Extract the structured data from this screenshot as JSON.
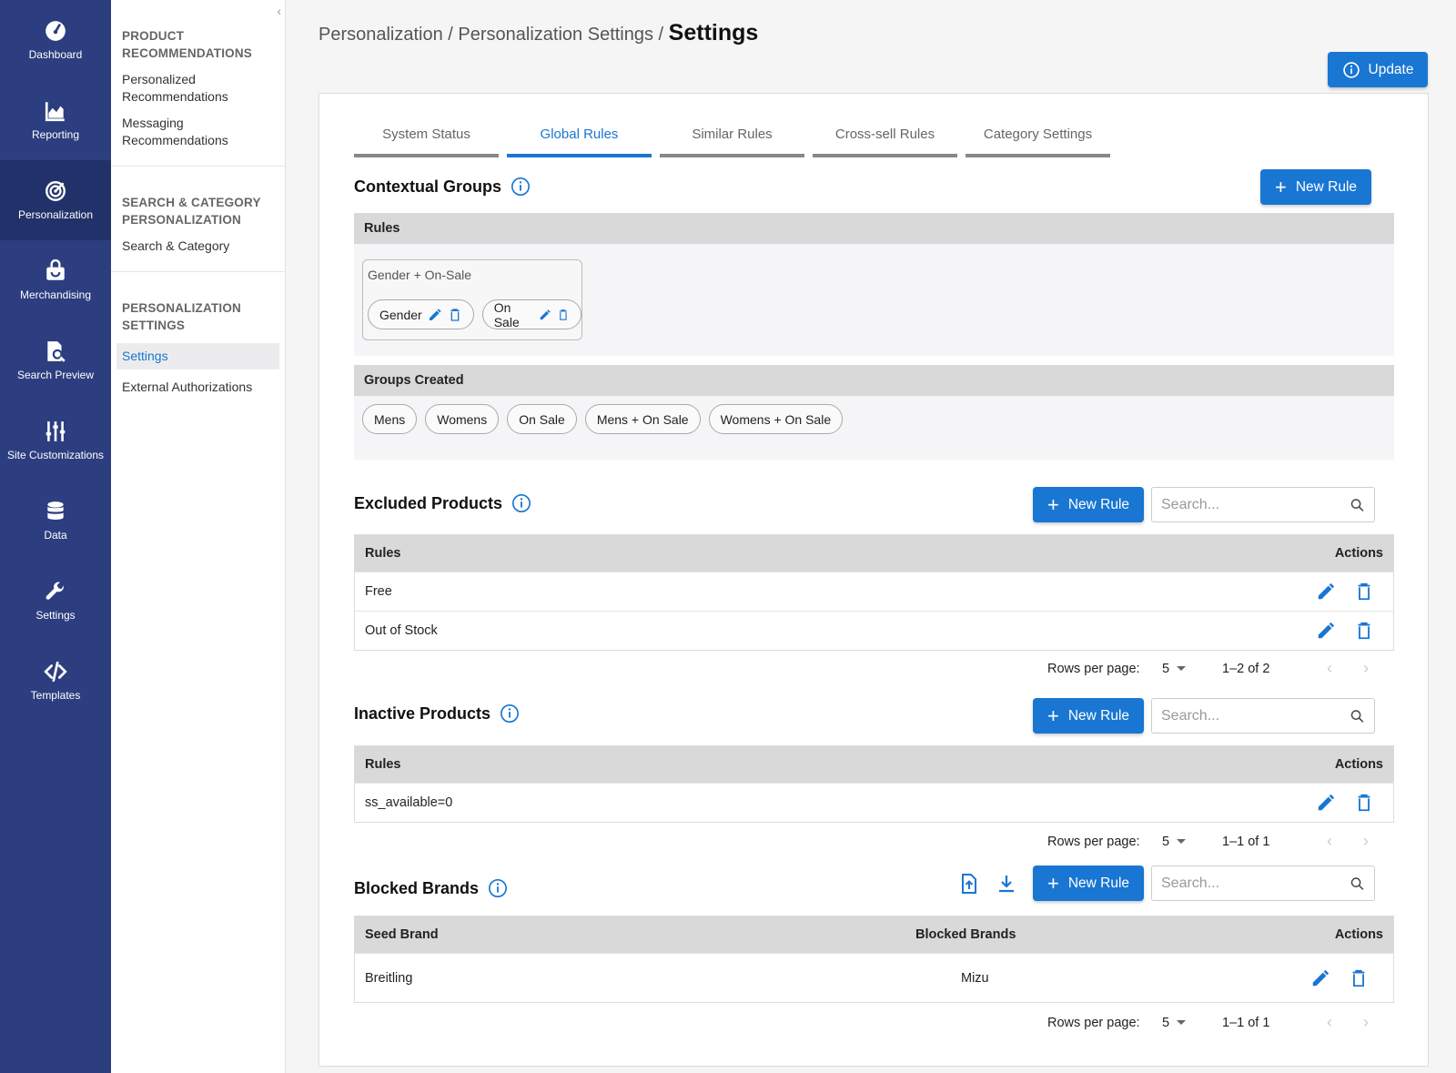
{
  "rail": {
    "items": [
      {
        "label": "Dashboard",
        "icon": "dashboard-gauge-icon"
      },
      {
        "label": "Reporting",
        "icon": "chart-icon"
      },
      {
        "label": "Personalization",
        "icon": "target-icon"
      },
      {
        "label": "Merchandising",
        "icon": "shopping-bag-icon"
      },
      {
        "label": "Search Preview",
        "icon": "search-document-icon"
      },
      {
        "label": "Site Customizations",
        "icon": "sliders-icon"
      },
      {
        "label": "Data",
        "icon": "database-icon"
      },
      {
        "label": "Settings",
        "icon": "wrench-icon"
      },
      {
        "label": "Templates",
        "icon": "code-icon"
      }
    ],
    "active": "Personalization"
  },
  "subnav": {
    "collapse_glyph": "‹",
    "sections": [
      {
        "heading_1": "PRODUCT",
        "heading_2": "RECOMMENDATIONS",
        "links": [
          "Personalized",
          "Recommendations",
          "Messaging",
          "Recommendations"
        ]
      },
      {
        "heading_1": "SEARCH & CATEGORY",
        "heading_2": "PERSONALIZATION",
        "links": [
          "Search & Category"
        ]
      },
      {
        "heading_1": "PERSONALIZATION",
        "heading_2": "SETTINGS",
        "links": [
          "Settings",
          "External Authorizations"
        ]
      }
    ]
  },
  "breadcrumb": {
    "parts": [
      "Personalization",
      "Personalization Settings"
    ],
    "separator": " / ",
    "current": "Settings"
  },
  "update_label": "Update",
  "tabs": [
    "System Status",
    "Global Rules",
    "Similar Rules",
    "Cross-sell Rules",
    "Category Settings"
  ],
  "active_tab": "Global Rules",
  "contextual": {
    "title": "Contextual Groups",
    "new_rule_label": "New Rule",
    "rules_header": "Rules",
    "group_name": "Gender + On-Sale",
    "group_pills": [
      "Gender",
      "On Sale"
    ],
    "groups_created_header": "Groups Created",
    "groups_created": [
      "Mens",
      "Womens",
      "On Sale",
      "Mens + On Sale",
      "Womens + On Sale"
    ]
  },
  "excluded": {
    "title": "Excluded Products",
    "new_rule_label": "New Rule",
    "search_placeholder": "Search...",
    "col_rules": "Rules",
    "col_actions": "Actions",
    "rows": [
      "Free",
      "Out of Stock"
    ],
    "rows_per_page_label": "Rows per page:",
    "rows_per_page": "5",
    "range": "1–2 of 2"
  },
  "inactive": {
    "title": "Inactive Products",
    "new_rule_label": "New Rule",
    "search_placeholder": "Search...",
    "col_rules": "Rules",
    "col_actions": "Actions",
    "rows": [
      "ss_available=0"
    ],
    "rows_per_page_label": "Rows per page:",
    "rows_per_page": "5",
    "range": "1–1 of 1"
  },
  "blocked": {
    "title": "Blocked Brands",
    "new_rule_label": "New Rule",
    "search_placeholder": "Search...",
    "col_seed": "Seed Brand",
    "col_blocked": "Blocked Brands",
    "col_actions": "Actions",
    "rows": [
      {
        "seed": "Breitling",
        "blocked": "Mizu"
      }
    ],
    "rows_per_page_label": "Rows per page:",
    "rows_per_page": "5",
    "range": "1–1 of 1"
  },
  "pager_prev": "‹",
  "pager_next": "›",
  "colors": {
    "rail": "#2c3e7f",
    "rail_active": "#22316a",
    "accent": "#1976d2"
  }
}
